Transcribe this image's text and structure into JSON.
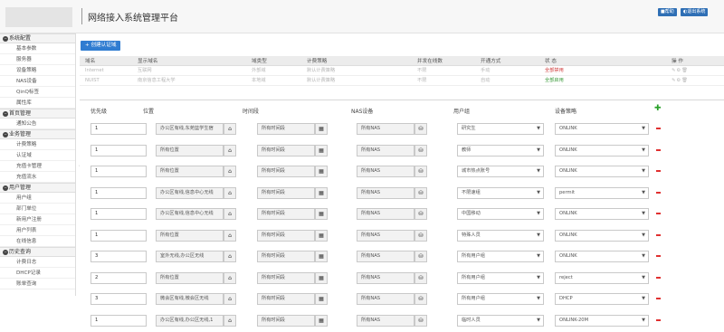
{
  "header": {
    "title": "网络接入系统管理平台",
    "btn_help": "■帮助",
    "btn_logout": "◐退出系统"
  },
  "sidebar": {
    "sections": [
      {
        "label": "系统配置",
        "items": [
          "基本参数",
          "服务器",
          "设备策略",
          "NAS设备",
          "QinQ标签",
          "属性库"
        ]
      },
      {
        "label": "首页管理",
        "items": [
          "通知公告"
        ]
      },
      {
        "label": "业务管理",
        "items": [
          "计费策略",
          "认证域",
          "充值卡管理",
          "充值流水"
        ]
      },
      {
        "label": "用户管理",
        "items": [
          "用户组",
          "部门单位",
          "新用户注册",
          "用户列表",
          "在线信息"
        ]
      },
      {
        "label": "历史查询",
        "items": [
          "计费日志",
          "DHCP记录",
          "账单查询"
        ]
      }
    ]
  },
  "toolbar": {
    "create_label": "+ 创建认证域"
  },
  "domain_table": {
    "columns": [
      "域名",
      "显示域名",
      "域类型",
      "计费策略",
      "并发在线数",
      "开通方式",
      "状 态",
      "操 作"
    ],
    "rows": [
      {
        "name": "Internet",
        "display": "互联网",
        "type": "外部域",
        "policy": "默认计费策略",
        "concurrent": "不限",
        "open": "手动",
        "status": "全部禁用",
        "status_color": "red"
      },
      {
        "name": "NUIST",
        "display": "南京信息工程大学",
        "type": "本地域",
        "policy": "默认计费策略",
        "concurrent": "不限",
        "open": "自动",
        "status": "全部启用",
        "status_color": "green"
      }
    ],
    "ops_icons": "✎⚙🗑"
  },
  "rules": {
    "headers": [
      "优先级",
      "位置",
      "时间段",
      "NAS设备",
      "用户组",
      "设备策略"
    ],
    "rows": [
      {
        "priority": "1",
        "location": "办公区有线,东苑篮学生宿",
        "time": "所有时间段",
        "nas": "所有NAS",
        "group": "研究生",
        "policy": "ONLINK"
      },
      {
        "priority": "1",
        "location": "所有位置",
        "time": "所有时间段",
        "nas": "所有NAS",
        "group": "教师",
        "policy": "ONLINK"
      },
      {
        "priority": "1",
        "location": "所有位置",
        "time": "所有时间段",
        "nas": "所有NAS",
        "group": "城市热点账号",
        "policy": "ONLINK"
      },
      {
        "priority": "1",
        "location": "办公区有线,信息中心无线",
        "time": "所有时间段",
        "nas": "所有NAS",
        "group": "不限速组",
        "policy": "permit"
      },
      {
        "priority": "1",
        "location": "办公区有线,信息中心无线",
        "time": "所有时间段",
        "nas": "所有NAS",
        "group": "中国移动",
        "policy": "ONLINK"
      },
      {
        "priority": "1",
        "location": "所有位置",
        "time": "所有时间段",
        "nas": "所有NAS",
        "group": "特殊人员",
        "policy": "ONLINK"
      },
      {
        "priority": "3",
        "location": "室外无线,办公区无线",
        "time": "所有时间段",
        "nas": "所有NAS",
        "group": "所有用户组",
        "policy": "ONLINK"
      },
      {
        "priority": "2",
        "location": "所有位置",
        "time": "所有时间段",
        "nas": "所有NAS",
        "group": "所有用户组",
        "policy": "reject"
      },
      {
        "priority": "3",
        "location": "微会区有线,微会区无线",
        "time": "所有时间段",
        "nas": "所有NAS",
        "group": "所有用户组",
        "policy": "DHCP"
      },
      {
        "priority": "1",
        "location": "办公区有线,办公区无线,1",
        "time": "所有时间段",
        "nas": "所有NAS",
        "group": "临时人员",
        "policy": "ONLINK-20M"
      }
    ]
  },
  "icons": {
    "home": "home-icon",
    "calendar": "calendar-icon",
    "nas": "router-icon",
    "add": "plus-icon",
    "remove": "minus-icon"
  },
  "colors": {
    "accent": "#2f7cd1",
    "green": "#2aa12a",
    "red": "#e03030"
  }
}
